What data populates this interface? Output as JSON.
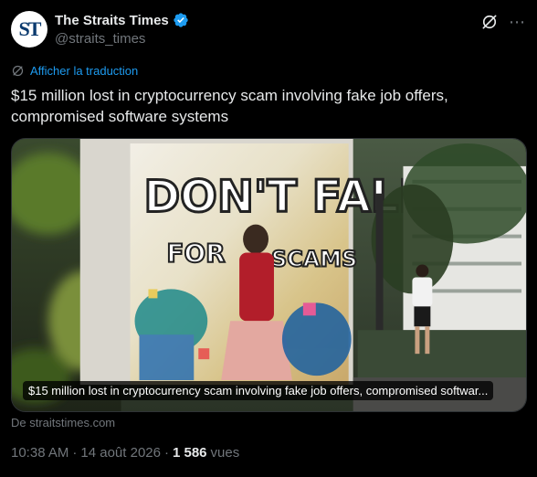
{
  "account": {
    "name": "The Straits Times",
    "handle": "@straits_times",
    "avatar_text": "ST",
    "verified_color": "#1d9bf0"
  },
  "translate_link": "Afficher la traduction",
  "tweet_text": "$15 million lost in cryptocurrency scam involving fake job offers, compromised software systems",
  "card": {
    "caption": "$15 million lost in cryptocurrency scam involving fake job offers, compromised softwar...",
    "mural_text_line1": "DON'T FALL",
    "mural_text_line2": "FOR",
    "mural_text_line3": "SCAMS",
    "source": "De straitstimes.com"
  },
  "meta": {
    "time": "10:38 AM",
    "separator": "·",
    "date": "14 août 2026",
    "separator2": "·",
    "views_count": "1 586",
    "views_label": "vues"
  },
  "colors": {
    "background": "#000000",
    "text_primary": "#e7e9ea",
    "text_secondary": "#71767b",
    "link": "#1d9bf0"
  },
  "icons": [
    "verified-badge-icon",
    "grok-icon",
    "more-options-icon",
    "translate-icon"
  ]
}
